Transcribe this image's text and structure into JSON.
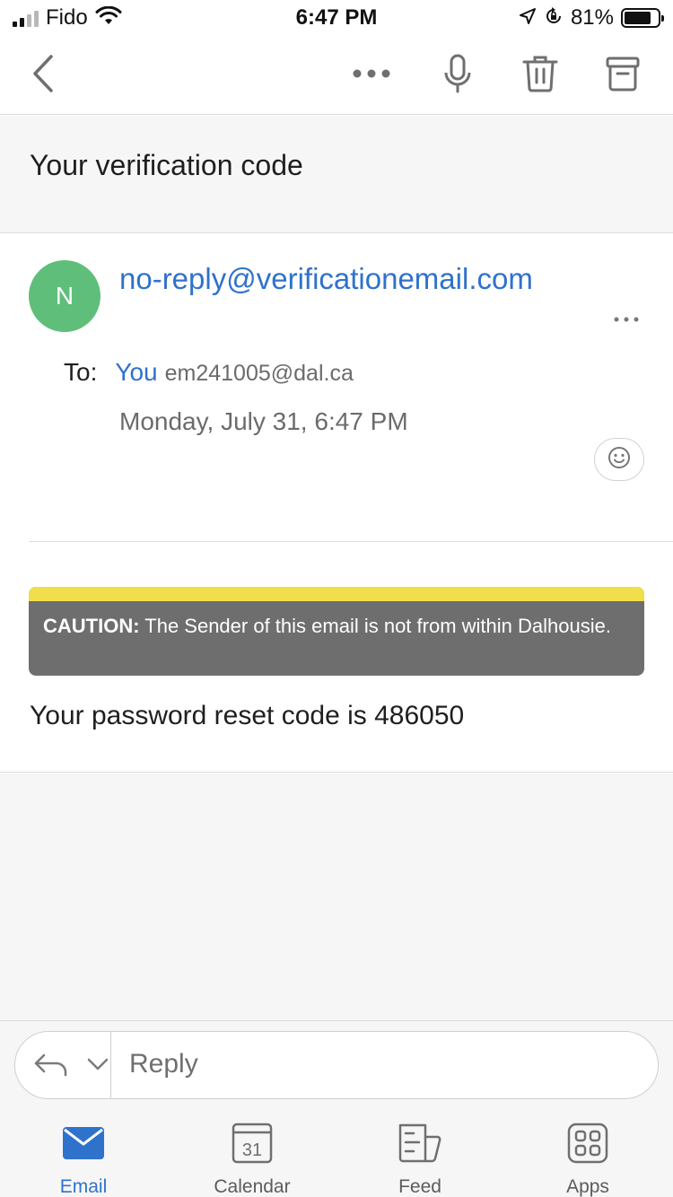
{
  "status_bar": {
    "carrier": "Fido",
    "time": "6:47 PM",
    "battery_percent": "81%",
    "battery_level": 0.81,
    "signal_bars": 2,
    "icons": [
      "signal-icon",
      "wifi-icon",
      "location-icon",
      "rotation-lock-icon",
      "battery-icon"
    ]
  },
  "toolbar": {
    "icons": [
      "back-chevron-icon",
      "more-icon",
      "microphone-icon",
      "trash-icon",
      "archive-icon"
    ]
  },
  "email": {
    "subject": "Your verification code",
    "avatar_initial": "N",
    "avatar_color": "#5fbf7a",
    "sender": "no-reply@verificationemail.com",
    "to_label": "To:",
    "to_name": "You",
    "to_email": "em241005@dal.ca",
    "date": "Monday, July 31, 6:47 PM",
    "caution_label": "CAUTION:",
    "caution_text": "The Sender of this email is not from within Dalhousie.",
    "body": "Your password reset code is 486050"
  },
  "reply": {
    "placeholder": "Reply"
  },
  "tabs": [
    {
      "label": "Email",
      "icon": "mail-icon",
      "active": true
    },
    {
      "label": "Calendar",
      "icon": "calendar-icon",
      "active": false,
      "icon_text": "31"
    },
    {
      "label": "Feed",
      "icon": "feed-icon",
      "active": false
    },
    {
      "label": "Apps",
      "icon": "apps-icon",
      "active": false
    }
  ],
  "colors": {
    "accent": "#2f72cc",
    "caution_stripe": "#f0df4a",
    "caution_bg": "#6e6e6e"
  }
}
